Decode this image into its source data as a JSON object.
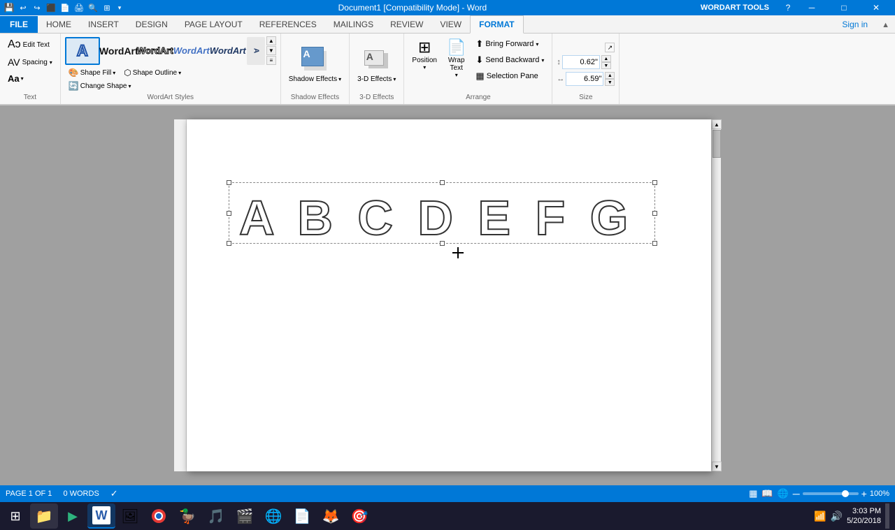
{
  "titlebar": {
    "title": "Document1 [Compatibility Mode] - Word",
    "wordart_tools": "WORDART TOOLS",
    "sign_in": "Sign in",
    "min_btn": "─",
    "max_btn": "□",
    "close_btn": "✕",
    "help_btn": "?"
  },
  "qat": {
    "buttons": [
      "💾",
      "↩",
      "↪",
      "⬛",
      "📄",
      "🖨",
      "🔍",
      "⚡"
    ]
  },
  "ribbon": {
    "tabs": [
      "FILE",
      "HOME",
      "INSERT",
      "DESIGN",
      "PAGE LAYOUT",
      "REFERENCES",
      "MAILINGS",
      "REVIEW",
      "VIEW"
    ],
    "active_tab": "FORMAT",
    "groups": {
      "text": {
        "label": "Text",
        "edit_text": "Edit Text",
        "spacing_label": "Spacing"
      },
      "wordart_styles": {
        "label": "WordArt Styles"
      },
      "shadow_effects": {
        "label": "Shadow Effects",
        "btn": "Shadow Effects ▾"
      },
      "threed_effects": {
        "label": "3-D Effects",
        "btn": "3-D Effects ▾"
      },
      "arrange": {
        "label": "Arrange",
        "bring_forward": "Bring Forward",
        "send_backward": "Send Backward",
        "selection_pane": "Selection Pane",
        "position": "Position",
        "wrap_text": "Wrap Text"
      },
      "size": {
        "label": "Size",
        "height": "0.62\"",
        "width": "6.59\""
      }
    }
  },
  "wordart_styles": [
    {
      "label": "A",
      "style": "outlined"
    },
    {
      "label": "WordArt",
      "style": "black"
    },
    {
      "label": "WordArt",
      "style": "outline-black"
    },
    {
      "label": "WordArt",
      "style": "blue-italic"
    },
    {
      "label": "WordArt",
      "style": "dark-blue-italic"
    }
  ],
  "document": {
    "content": "A B C D E F G",
    "letters": [
      "A",
      "B",
      "C",
      "D",
      "E",
      "F",
      "G"
    ]
  },
  "statusbar": {
    "page": "PAGE 1 OF 1",
    "words": "0 WORDS",
    "zoom": "100%"
  },
  "taskbar": {
    "time": "3:03 PM",
    "date": "5/20/2018",
    "apps": [
      {
        "icon": "⊞",
        "color": "#1a1a2e",
        "name": "start"
      },
      {
        "icon": "📁",
        "color": "#f0a500",
        "name": "explorer"
      },
      {
        "icon": "▶",
        "color": "#2db37d",
        "name": "media-player"
      },
      {
        "icon": "W",
        "color": "#2a5caa",
        "name": "word"
      },
      {
        "icon": "🖼",
        "color": "#6a6a6a",
        "name": "photos"
      },
      {
        "icon": "G",
        "color": "#e53935",
        "name": "chrome"
      },
      {
        "icon": "🦆",
        "color": "#e57b00",
        "name": "duckduckgo"
      },
      {
        "icon": "V",
        "color": "#f0a500",
        "name": "vlc"
      },
      {
        "icon": "🎬",
        "color": "#1a1a1a",
        "name": "video-editor"
      },
      {
        "icon": "🌐",
        "color": "#ff6600",
        "name": "browser"
      },
      {
        "icon": "📄",
        "color": "#cc0000",
        "name": "pdf"
      },
      {
        "icon": "🦊",
        "color": "#cc4400",
        "name": "firefox"
      },
      {
        "icon": "🎯",
        "color": "#cc2200",
        "name": "app13"
      }
    ]
  },
  "shape_fill_label": "Shape Fill",
  "shape_outline_label": "Shape Outline",
  "change_shape_label": "Change Shape"
}
